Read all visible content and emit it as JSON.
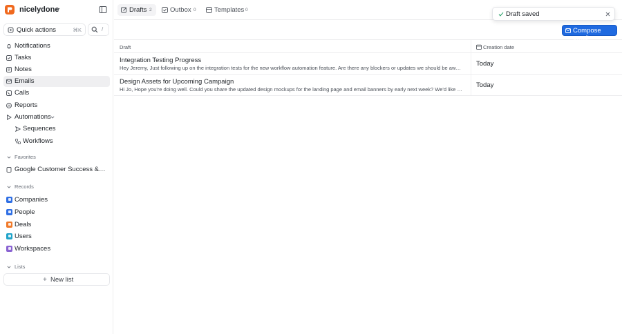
{
  "workspace": {
    "name": "nicelydone"
  },
  "quick_actions": {
    "label": "Quick actions",
    "shortcut": "⌘K",
    "search_shortcut": "/"
  },
  "nav": [
    {
      "label": "Notifications",
      "icon": "bell-icon"
    },
    {
      "label": "Tasks",
      "icon": "checkbox-icon"
    },
    {
      "label": "Notes",
      "icon": "note-icon"
    },
    {
      "label": "Emails",
      "icon": "mail-icon",
      "active": true
    },
    {
      "label": "Calls",
      "icon": "phone-icon"
    },
    {
      "label": "Reports",
      "icon": "chart-icon"
    },
    {
      "label": "Automations",
      "icon": "play-icon"
    },
    {
      "label": "Sequences",
      "icon": "send-icon"
    },
    {
      "label": "Workflows",
      "icon": "workflow-icon"
    }
  ],
  "favorites": {
    "title": "Favorites",
    "items": [
      {
        "label": "Google Customer Success & Partnerships"
      }
    ]
  },
  "records": {
    "title": "Records",
    "items": [
      {
        "label": "Companies",
        "color": "#2f6fe4"
      },
      {
        "label": "People",
        "color": "#2f6fe4"
      },
      {
        "label": "Deals",
        "color": "#f07a2a"
      },
      {
        "label": "Users",
        "color": "#1fa3c9"
      },
      {
        "label": "Workspaces",
        "color": "#8a63d2"
      }
    ]
  },
  "lists": {
    "title": "Lists",
    "new_list": "New list"
  },
  "tabs": [
    {
      "label": "Drafts",
      "count": "2",
      "active": true
    },
    {
      "label": "Outbox",
      "count": "0"
    },
    {
      "label": "Templates",
      "count": "0"
    }
  ],
  "compose": {
    "label": "Compose email",
    "color": "#1f6ae0"
  },
  "table": {
    "columns": [
      "Draft",
      "Creation date"
    ],
    "rows": [
      {
        "subject": "Integration Testing Progress",
        "preview": "Hey Jeremy, Just following up on the integration tests for the new workflow automation feature. Are there any blockers or updates we should be aware of?",
        "date": "Today"
      },
      {
        "subject": "Design Assets for Upcoming Campaign",
        "preview": "Hi Jo, Hope you're doing well. Could you share the updated design mockups for the landing page and email banners by early next week? We'd like to review them.",
        "date": "Today"
      }
    ]
  },
  "toast": {
    "message": "Draft saved"
  }
}
